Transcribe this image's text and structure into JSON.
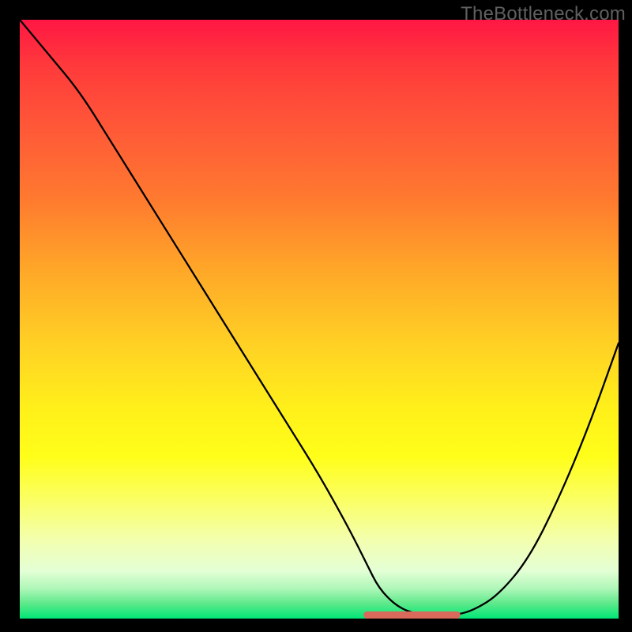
{
  "watermark": "TheBottleneck.com",
  "chart_data": {
    "type": "line",
    "title": "",
    "xlabel": "",
    "ylabel": "",
    "xlim": [
      0,
      100
    ],
    "ylim": [
      0,
      100
    ],
    "grid": false,
    "series": [
      {
        "name": "curve",
        "color": "#000000",
        "x": [
          0,
          5,
          10,
          15,
          20,
          25,
          30,
          35,
          40,
          45,
          50,
          55,
          58,
          60,
          63,
          66,
          69,
          70,
          73,
          76,
          80,
          85,
          90,
          95,
          100
        ],
        "y": [
          100,
          94,
          88,
          80,
          72,
          64,
          56,
          48,
          40,
          32,
          24,
          15,
          9,
          5,
          2,
          0.8,
          0.6,
          0.6,
          0.6,
          1.5,
          4,
          10,
          20,
          32,
          46
        ]
      },
      {
        "name": "flat-segment",
        "color": "#d96a5b",
        "x": [
          58,
          73
        ],
        "y": [
          0.6,
          0.6
        ]
      }
    ],
    "gradient_stops": [
      {
        "pos": 0,
        "color": "#ff1744"
      },
      {
        "pos": 0.08,
        "color": "#ff3b3b"
      },
      {
        "pos": 0.18,
        "color": "#ff5838"
      },
      {
        "pos": 0.3,
        "color": "#ff7a2f"
      },
      {
        "pos": 0.42,
        "color": "#ffa828"
      },
      {
        "pos": 0.55,
        "color": "#ffd324"
      },
      {
        "pos": 0.65,
        "color": "#fff01a"
      },
      {
        "pos": 0.73,
        "color": "#fffe1a"
      },
      {
        "pos": 0.8,
        "color": "#fbff62"
      },
      {
        "pos": 0.87,
        "color": "#f3ffb0"
      },
      {
        "pos": 0.92,
        "color": "#e4ffd6"
      },
      {
        "pos": 0.95,
        "color": "#aef7b8"
      },
      {
        "pos": 0.975,
        "color": "#5de98a"
      },
      {
        "pos": 1.0,
        "color": "#00e676"
      }
    ]
  }
}
